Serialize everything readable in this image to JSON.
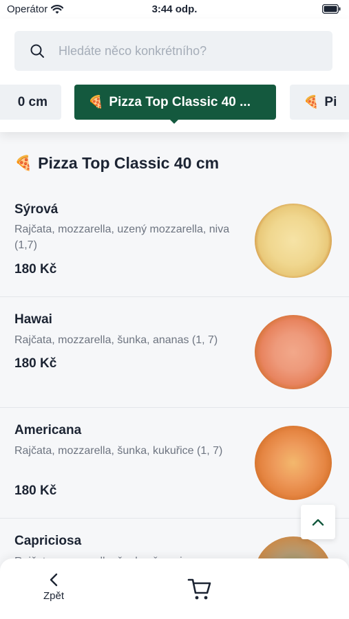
{
  "status_bar": {
    "carrier": "Operátor",
    "time": "3:44 odp."
  },
  "search": {
    "placeholder": "Hledáte něco konkrétního?"
  },
  "categories": [
    {
      "label": "0 cm",
      "state": "partial-left"
    },
    {
      "label": "Pizza Top Classic 40 ...",
      "state": "active"
    },
    {
      "label": "Pi",
      "state": "partial-right"
    }
  ],
  "section": {
    "title": "Pizza Top Classic 40 cm",
    "icon": "pizza-icon"
  },
  "items": [
    {
      "name": "Sýrová",
      "description": "Rajčata, mozzarella, uzený mozzarella, niva (1,7)",
      "price": "180 Kč",
      "image": "cheese-pizza"
    },
    {
      "name": "Hawai",
      "description": "Rajčata, mozzarella, šunka, ananas (1, 7)",
      "price": "180 Kč",
      "image": "hawai-pizza"
    },
    {
      "name": "Americana",
      "description": "Rajčata, mozzarella, šunka, kukuřice (1, 7)",
      "price": "180 Kč",
      "image": "americana-pizza"
    },
    {
      "name": "Capriciosa",
      "description": "Rajčata, mozzarella, šunka, žampiony",
      "price": "",
      "image": "capriciosa-pizza"
    }
  ],
  "bottom_nav": {
    "back_label": "Zpět",
    "back_icon": "chevron-left-icon",
    "cart_icon": "cart-icon"
  },
  "colors": {
    "accent": "#14593e",
    "text": "#1c2433",
    "muted": "#6d7480",
    "background": "#f6f7f9"
  }
}
